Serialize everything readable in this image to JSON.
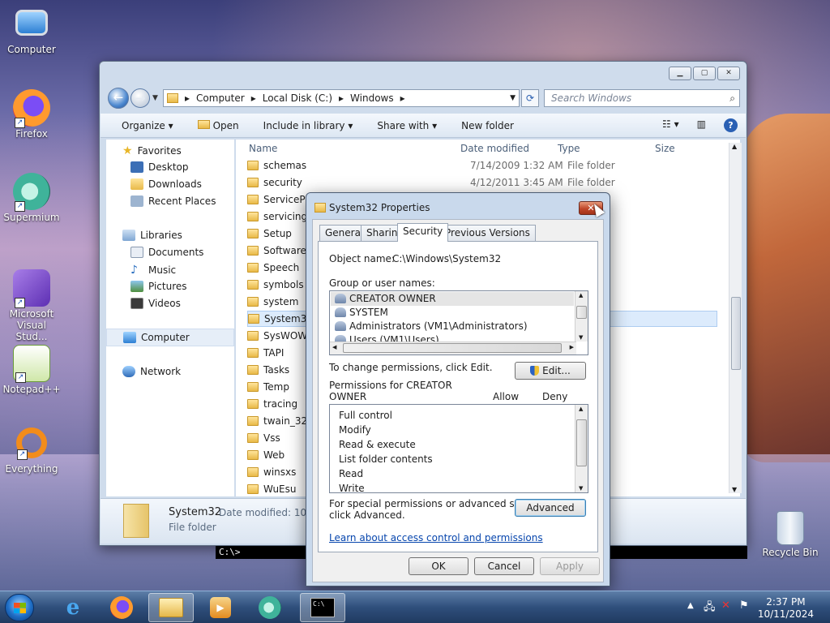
{
  "desktop": {
    "icons": [
      {
        "label": "Computer",
        "icon": "computer-icon"
      },
      {
        "label": "Firefox",
        "icon": "firefox-icon"
      },
      {
        "label": "Supermium",
        "icon": "supermium-icon"
      },
      {
        "label": "Microsoft Visual Stud...",
        "icon": "visual-studio-icon"
      },
      {
        "label": "Notepad++",
        "icon": "notepadpp-icon"
      },
      {
        "label": "Everything",
        "icon": "everything-icon"
      },
      {
        "label": "Recycle Bin",
        "icon": "recycle-bin-icon"
      }
    ]
  },
  "explorer": {
    "breadcrumb": [
      "Computer",
      "Local Disk (C:)",
      "Windows"
    ],
    "search_placeholder": "Search Windows",
    "toolbar": {
      "organize": "Organize",
      "open": "Open",
      "include": "Include in library",
      "share": "Share with",
      "new_folder": "New folder"
    },
    "nav": {
      "favorites": "Favorites",
      "desktop": "Desktop",
      "downloads": "Downloads",
      "recent": "Recent Places",
      "libraries": "Libraries",
      "documents": "Documents",
      "music": "Music",
      "pictures": "Pictures",
      "videos": "Videos",
      "computer": "Computer",
      "network": "Network"
    },
    "columns": {
      "name": "Name",
      "date": "Date modified",
      "type": "Type",
      "size": "Size"
    },
    "rows": [
      {
        "name": "schemas",
        "date": "7/14/2009 1:32 AM",
        "type": "File folder"
      },
      {
        "name": "security",
        "date": "4/12/2011 3:45 AM",
        "type": "File folder"
      },
      {
        "name": "ServicePr",
        "date": "",
        "type": ""
      },
      {
        "name": "servicing",
        "date": "",
        "type": ""
      },
      {
        "name": "Setup",
        "date": "",
        "type": ""
      },
      {
        "name": "SoftwareL",
        "date": "",
        "type": ""
      },
      {
        "name": "Speech",
        "date": "",
        "type": ""
      },
      {
        "name": "symbols",
        "date": "",
        "type": ""
      },
      {
        "name": "system",
        "date": "",
        "type": ""
      },
      {
        "name": "System32",
        "date": "",
        "type": ""
      },
      {
        "name": "SysWOW",
        "date": "",
        "type": ""
      },
      {
        "name": "TAPI",
        "date": "",
        "type": ""
      },
      {
        "name": "Tasks",
        "date": "",
        "type": ""
      },
      {
        "name": "Temp",
        "date": "",
        "type": ""
      },
      {
        "name": "tracing",
        "date": "",
        "type": ""
      },
      {
        "name": "twain_32",
        "date": "",
        "type": ""
      },
      {
        "name": "Vss",
        "date": "",
        "type": ""
      },
      {
        "name": "Web",
        "date": "",
        "type": ""
      },
      {
        "name": "winsxs",
        "date": "",
        "type": ""
      },
      {
        "name": "WuEsu",
        "date": "",
        "type": ""
      }
    ],
    "details": {
      "name": "System32",
      "date_label": "Date modified: 10/11",
      "type": "File folder"
    }
  },
  "console": {
    "prompt": "C:\\>"
  },
  "dialog": {
    "title": "System32 Properties",
    "tabs": [
      "General",
      "Sharing",
      "Security",
      "Previous Versions"
    ],
    "object_label": "Object name:",
    "object_value": "C:\\Windows\\System32",
    "group_label": "Group or user names:",
    "users": [
      "CREATOR OWNER",
      "SYSTEM",
      "Administrators (VM1\\Administrators)",
      "Users (VM1\\Users)"
    ],
    "change_text": "To change permissions, click Edit.",
    "edit_button": "Edit...",
    "perm_label_1": "Permissions for CREATOR",
    "perm_label_2": "OWNER",
    "allow": "Allow",
    "deny": "Deny",
    "permissions": [
      "Full control",
      "Modify",
      "Read & execute",
      "List folder contents",
      "Read",
      "Write"
    ],
    "special_1": "For special permissions or advanced settings,",
    "special_2": "click Advanced.",
    "advanced_button": "Advanced",
    "learn_link": "Learn about access control and permissions",
    "ok": "OK",
    "cancel": "Cancel",
    "apply": "Apply"
  },
  "taskbar": {
    "time": "2:37 PM",
    "date": "10/11/2024"
  }
}
